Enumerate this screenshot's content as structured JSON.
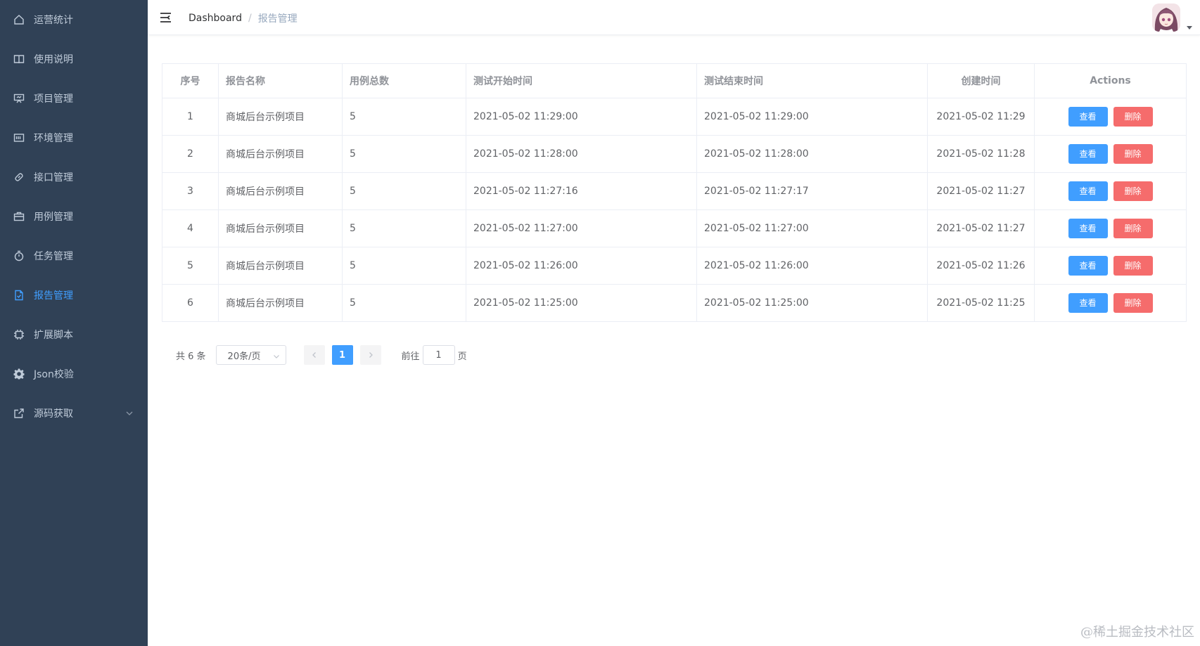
{
  "sidebar": {
    "items": [
      {
        "label": "运营统计",
        "icon": "home-icon"
      },
      {
        "label": "使用说明",
        "icon": "book-icon"
      },
      {
        "label": "项目管理",
        "icon": "presentation-icon"
      },
      {
        "label": "环境管理",
        "icon": "monitor-icon"
      },
      {
        "label": "接口管理",
        "icon": "link-icon"
      },
      {
        "label": "用例管理",
        "icon": "briefcase-icon"
      },
      {
        "label": "任务管理",
        "icon": "stopwatch-icon"
      },
      {
        "label": "报告管理",
        "icon": "document-icon",
        "active": true
      },
      {
        "label": "扩展脚本",
        "icon": "cpu-icon"
      },
      {
        "label": "Json校验",
        "icon": "gear-icon"
      },
      {
        "label": "源码获取",
        "icon": "external-link-icon"
      }
    ]
  },
  "breadcrumb": {
    "home": "Dashboard",
    "separator": "/",
    "current": "报告管理"
  },
  "table": {
    "headers": [
      "序号",
      "报告名称",
      "用例总数",
      "测试开始时间",
      "测试结束时间",
      "创建时间",
      "Actions"
    ],
    "rows": [
      {
        "no": "1",
        "name": "商城后台示例项目",
        "total": "5",
        "start": "2021-05-02 11:29:00",
        "end": "2021-05-02 11:29:00",
        "created": "2021-05-02 11:29"
      },
      {
        "no": "2",
        "name": "商城后台示例项目",
        "total": "5",
        "start": "2021-05-02 11:28:00",
        "end": "2021-05-02 11:28:00",
        "created": "2021-05-02 11:28"
      },
      {
        "no": "3",
        "name": "商城后台示例项目",
        "total": "5",
        "start": "2021-05-02 11:27:16",
        "end": "2021-05-02 11:27:17",
        "created": "2021-05-02 11:27"
      },
      {
        "no": "4",
        "name": "商城后台示例项目",
        "total": "5",
        "start": "2021-05-02 11:27:00",
        "end": "2021-05-02 11:27:00",
        "created": "2021-05-02 11:27"
      },
      {
        "no": "5",
        "name": "商城后台示例项目",
        "total": "5",
        "start": "2021-05-02 11:26:00",
        "end": "2021-05-02 11:26:00",
        "created": "2021-05-02 11:26"
      },
      {
        "no": "6",
        "name": "商城后台示例项目",
        "total": "5",
        "start": "2021-05-02 11:25:00",
        "end": "2021-05-02 11:25:00",
        "created": "2021-05-02 11:25"
      }
    ],
    "view_label": "查看",
    "delete_label": "删除"
  },
  "pagination": {
    "total_text": "共 6 条",
    "page_size": "20条/页",
    "current_page": "1",
    "goto_label": "前往",
    "goto_value": "1",
    "page_suffix": "页"
  },
  "watermark": "@稀土掘金技术社区",
  "colors": {
    "sidebar_bg": "#304156",
    "accent": "#409eff",
    "danger": "#f56c6c"
  }
}
